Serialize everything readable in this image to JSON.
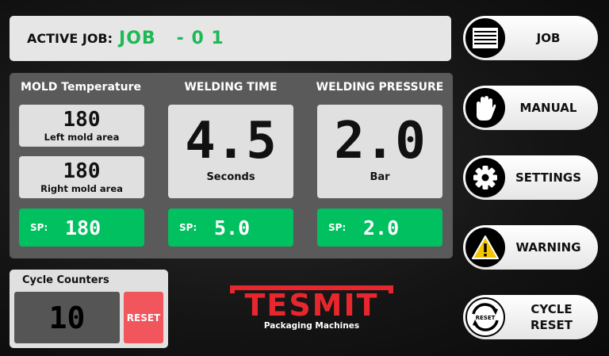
{
  "active_job": {
    "label": "ACTIVE JOB:",
    "value": "JOB   - 0 1"
  },
  "mold": {
    "title": "MOLD Temperature",
    "left": {
      "value": "180",
      "caption": "Left mold area"
    },
    "right": {
      "value": "180",
      "caption": "Right mold area"
    },
    "sp_label": "SP:",
    "sp_value": "180"
  },
  "welding_time": {
    "title": "WELDING TIME",
    "value": "4.5",
    "unit": "Seconds",
    "sp_label": "SP:",
    "sp_value": "5.0"
  },
  "welding_pressure": {
    "title": "WELDING PRESSURE",
    "value": "2.0",
    "unit": "Bar",
    "sp_label": "SP:",
    "sp_value": "2.0"
  },
  "cycle_counters": {
    "title": "Cycle Counters",
    "value": "10",
    "reset_label": "RESET"
  },
  "logo": {
    "name": "TESMIT",
    "tagline": "Packaging Machines"
  },
  "nav": [
    {
      "label": "JOB",
      "icon": "list-icon"
    },
    {
      "label": "MANUAL",
      "icon": "hand-icon"
    },
    {
      "label": "SETTINGS",
      "icon": "gear-icon"
    },
    {
      "label": "WARNING",
      "icon": "warning-icon"
    },
    {
      "label": "CYCLE RESET",
      "icon": "reset-icon",
      "icon_text": "RESET"
    }
  ],
  "colors": {
    "accent_green": "#00c060",
    "reset_red": "#f0565b",
    "brand_red": "#e8262d"
  }
}
